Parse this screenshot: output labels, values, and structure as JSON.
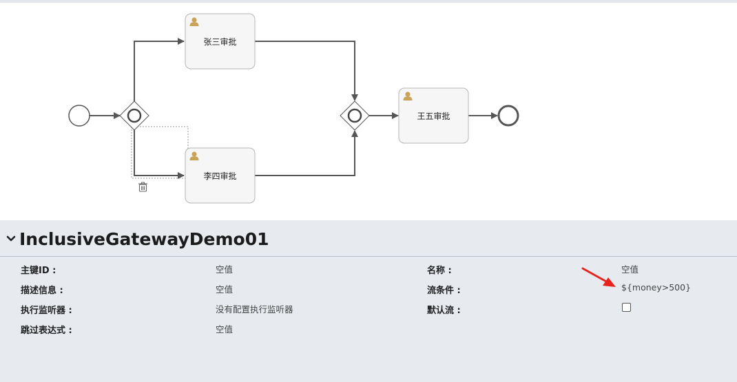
{
  "diagram": {
    "tasks": [
      {
        "label": "张三审批"
      },
      {
        "label": "李四审批"
      },
      {
        "label": "王五审批"
      }
    ]
  },
  "properties": {
    "title": "InclusiveGatewayDemo01",
    "left": [
      {
        "label": "主键ID :",
        "value": "空值"
      },
      {
        "label": "描述信息 :",
        "value": "空值"
      },
      {
        "label": "执行监听器 :",
        "value": "没有配置执行监听器"
      },
      {
        "label": "跳过表达式 :",
        "value": "空值"
      }
    ],
    "right": [
      {
        "label": "名称 :",
        "value": "空值"
      },
      {
        "label": "流条件 :",
        "value": "${money>500}"
      },
      {
        "label": "默认流 :",
        "checked": false
      }
    ]
  },
  "colors": {
    "annotation_arrow": "#e8231e",
    "user_icon": "#c9a35a",
    "panel_bg": "#e7ebf0"
  }
}
